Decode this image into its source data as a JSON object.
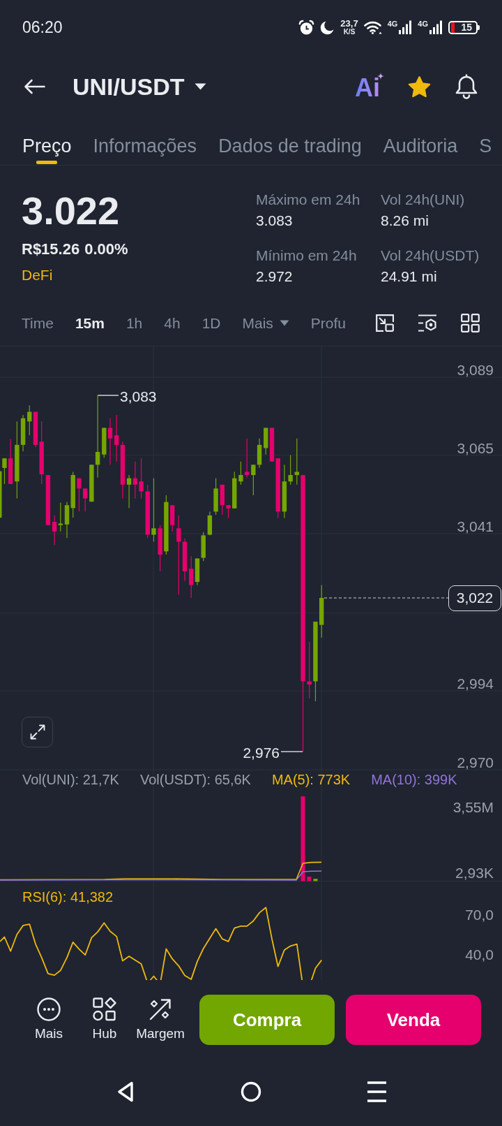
{
  "status_bar": {
    "time": "06:20",
    "speed": "23,7",
    "speed_unit": "K/S",
    "networks": [
      "4G",
      "4G"
    ],
    "battery": "15"
  },
  "header": {
    "title": "UNI/USDT",
    "ai_label": "Ai",
    "favorite": true
  },
  "tabs": [
    {
      "label": "Preço",
      "selected": true
    },
    {
      "label": "Informações",
      "selected": false
    },
    {
      "label": "Dados de trading",
      "selected": false
    },
    {
      "label": "Auditoria",
      "selected": false
    },
    {
      "label": "S",
      "selected": false
    }
  ],
  "price": {
    "last": "3.022",
    "fiat": "R$15.26",
    "change": "0.00%",
    "category": "DeFi"
  },
  "stats": [
    {
      "label": "Máximo em 24h",
      "value": "3.083"
    },
    {
      "label": "Vol 24h(UNI)",
      "value": "8.26 mi"
    },
    {
      "label": "Mínimo em 24h",
      "value": "2.972"
    },
    {
      "label": "Vol 24h(USDT)",
      "value": "24.91 mi"
    }
  ],
  "intervals": [
    {
      "label": "Time",
      "kind": "option",
      "selected": false
    },
    {
      "label": "15m",
      "kind": "option",
      "selected": true
    },
    {
      "label": "1h",
      "kind": "option",
      "selected": false
    },
    {
      "label": "4h",
      "kind": "option",
      "selected": false
    },
    {
      "label": "1D",
      "kind": "option",
      "selected": false
    },
    {
      "label": "Mais",
      "kind": "dropdown",
      "selected": false
    },
    {
      "label": "Profu",
      "kind": "option",
      "selected": false
    }
  ],
  "chart": {
    "price_axis": [
      "3,089",
      "3,065",
      "3,041",
      "2,994",
      "2,970"
    ],
    "high_marker": "3,083",
    "low_marker": "2,976",
    "last_price": "3,022"
  },
  "volume": {
    "legend": [
      {
        "text": "Vol(UNI): 21,7K",
        "color": "#9aa1ab"
      },
      {
        "text": "Vol(USDT): 65,6K",
        "color": "#9aa1ab"
      },
      {
        "text": "MA(5): 773K",
        "color": "#f0b90b"
      },
      {
        "text": "MA(10): 399K",
        "color": "#9373d9"
      }
    ],
    "axis": [
      "3,55M",
      "2,93K"
    ]
  },
  "rsi": {
    "legend": {
      "text": "RSI(6): 41,382",
      "color": "#f0b90b"
    },
    "axis": [
      "70,0",
      "40,0"
    ]
  },
  "actions": [
    {
      "label": "Mais"
    },
    {
      "label": "Hub"
    },
    {
      "label": "Margem"
    }
  ],
  "trade_buttons": [
    {
      "label": "Compra",
      "kind": "buy"
    },
    {
      "label": "Venda",
      "kind": "sell"
    }
  ]
}
